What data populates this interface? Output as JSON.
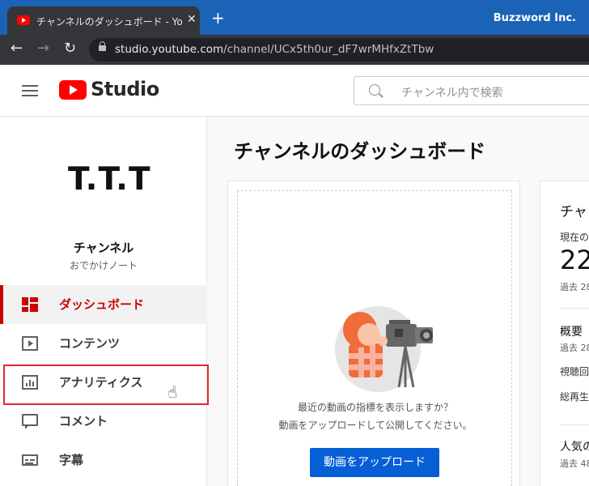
{
  "browser": {
    "tab_title": "チャンネルのダッシュボード - YouTube",
    "tab_close": "✕",
    "new_tab": "+",
    "profile": "Buzzword Inc.",
    "back": "←",
    "forward": "→",
    "reload": "↻",
    "url_host": "studio.youtube.com",
    "url_path": "/channel/UCx5th0ur_dF7wrMHfxZtTbw"
  },
  "header": {
    "logo_text": "Studio",
    "search_placeholder": "チャンネル内で検索"
  },
  "sidebar": {
    "avatar_text": "T.T.T",
    "channel_label": "チャンネル",
    "channel_name": "おでかけノート",
    "items": [
      {
        "label": "ダッシュボード",
        "icon": "dashboard-icon"
      },
      {
        "label": "コンテンツ",
        "icon": "content-icon"
      },
      {
        "label": "アナリティクス",
        "icon": "analytics-icon"
      },
      {
        "label": "コメント",
        "icon": "comment-icon"
      },
      {
        "label": "字幕",
        "icon": "subtitles-icon"
      }
    ]
  },
  "main": {
    "title": "チャンネルのダッシュボード",
    "promo_line1": "最近の動画の指標を表示しますか？",
    "promo_line2": "動画をアップロードして公開してください。",
    "upload_button": "動画をアップロード"
  },
  "analytics_card": {
    "title": "チャ",
    "current": "現在の",
    "count": "22",
    "past1": "過去 28",
    "summary": "概要",
    "past2": "過去 28",
    "views": "視聴回",
    "watch": "総再生",
    "popular": "人気の",
    "past3": "過去 48"
  },
  "colors": {
    "accent": "#cc0000",
    "button": "#065fd4",
    "browser_tabbar": "#1a63b7"
  }
}
